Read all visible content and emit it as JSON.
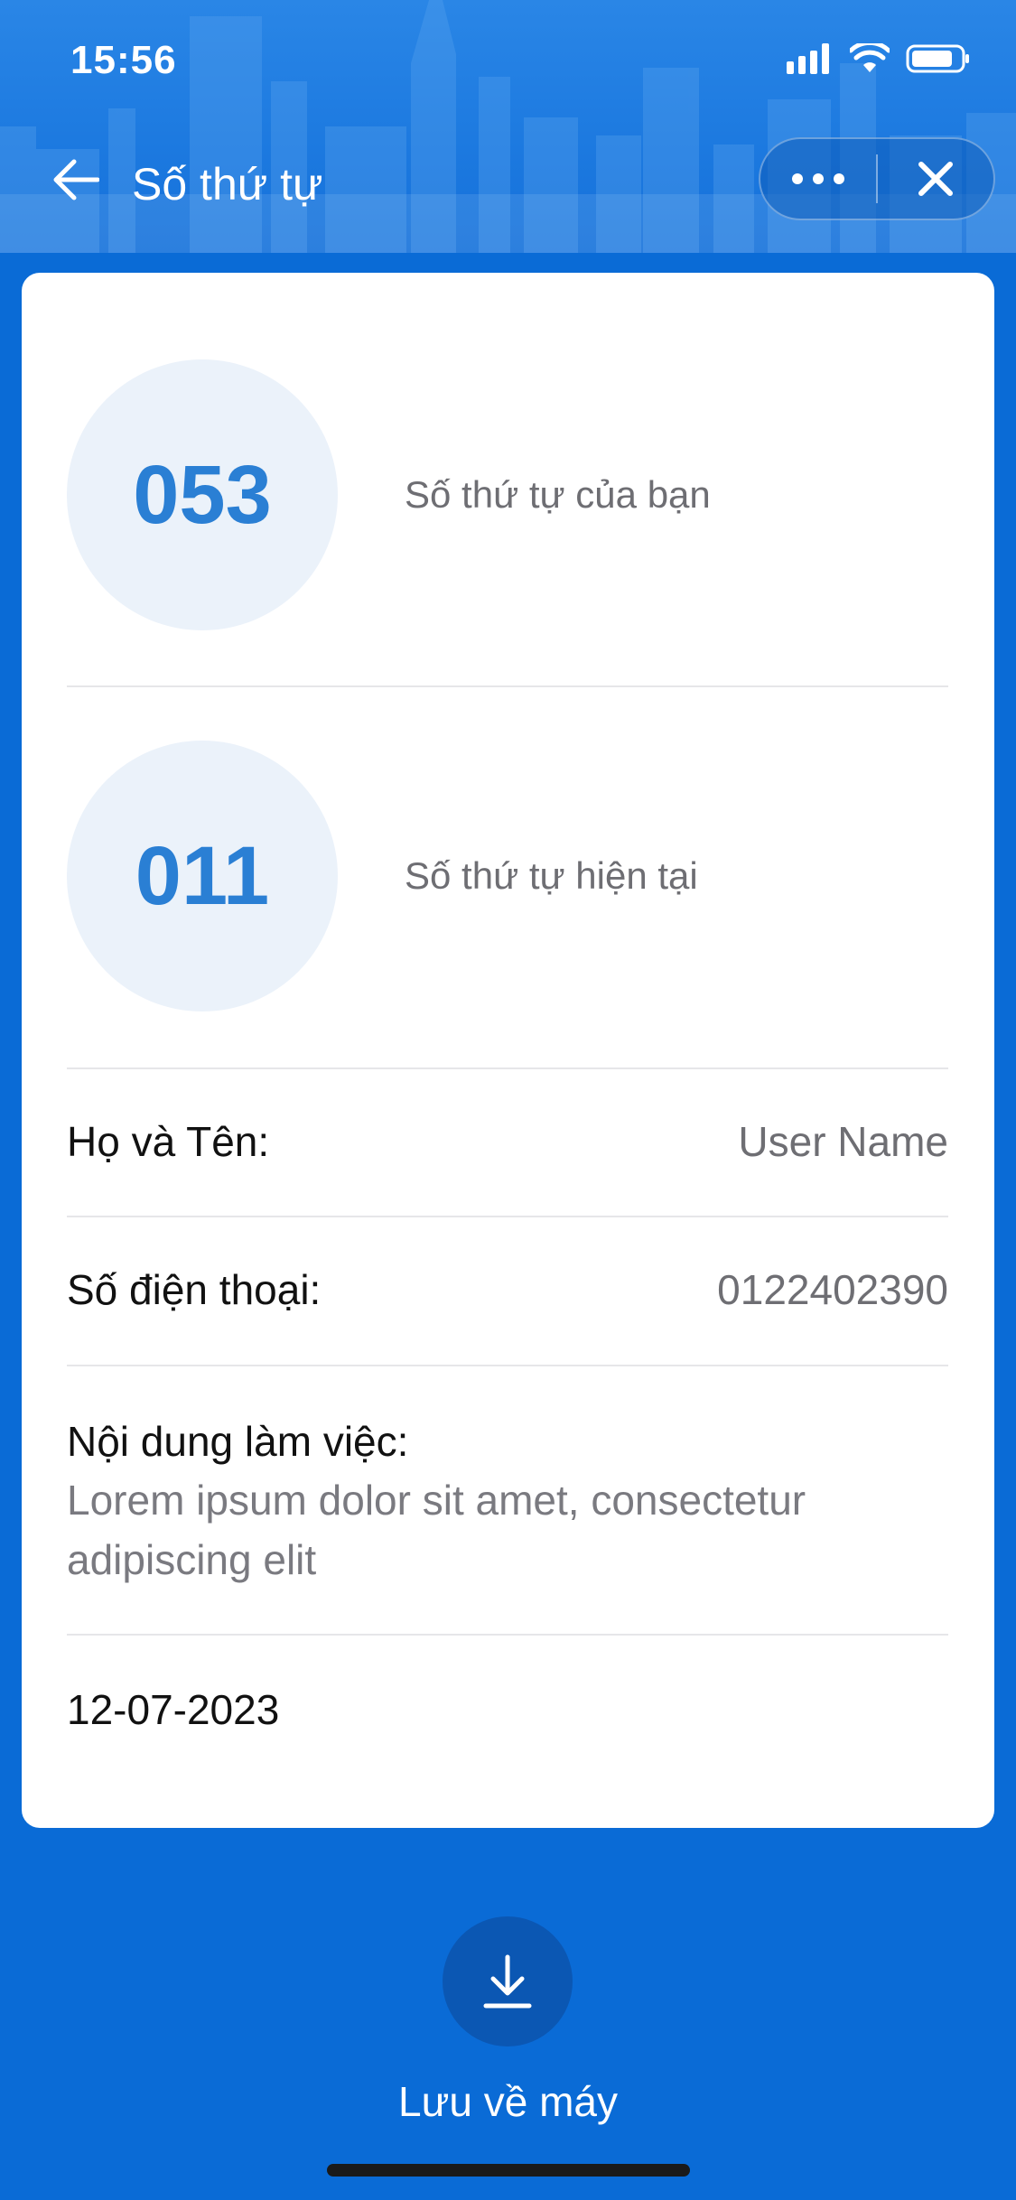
{
  "status_bar": {
    "time": "15:56",
    "icons": [
      "signal-icon",
      "wifi-icon",
      "battery-icon"
    ]
  },
  "nav": {
    "title": "Số thứ tự",
    "back_icon": "arrow-left-icon",
    "more_icon": "more-dots-icon",
    "close_icon": "close-icon"
  },
  "queue": {
    "your_number": "053",
    "your_label": "Số thứ tự của bạn",
    "current_number": "011",
    "current_label": "Số thứ tự hiện tại"
  },
  "details": {
    "name_label": "Họ và Tên:",
    "name_value": "User Name",
    "phone_label": "Số điện thoại:",
    "phone_value": "0122402390",
    "content_label": "Nội dung làm việc:",
    "content_value": "Lorem ipsum dolor sit amet, consectetur adipiscing elit",
    "date": "12-07-2023"
  },
  "save": {
    "label": "Lưu về máy",
    "icon": "download-icon"
  },
  "colors": {
    "background": "#0a6bd6",
    "accent": "#2a7fd4",
    "circle_bg": "#ebf2fa",
    "save_button": "#0b57b3"
  }
}
